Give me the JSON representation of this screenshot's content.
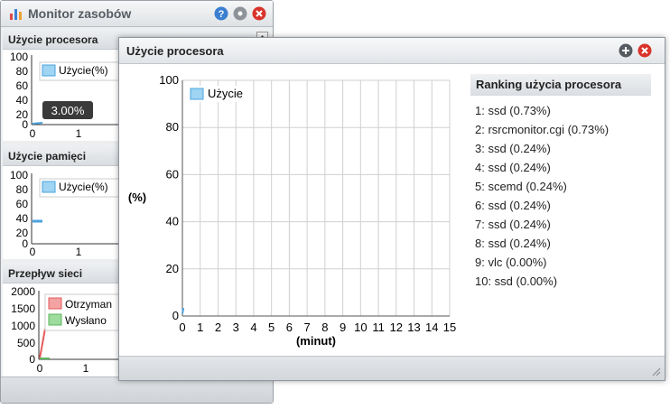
{
  "monitor_window": {
    "title": "Monitor zasobów",
    "sections": {
      "cpu": {
        "title": "Użycie procesora",
        "legend": "Użycie(%)",
        "tooltip": "3.00%",
        "y_ticks": [
          "100",
          "80",
          "60",
          "40",
          "20",
          "0"
        ],
        "x_ticks": [
          "0",
          "1"
        ]
      },
      "memory": {
        "title": "Użycie pamięci",
        "legend": "Użycie(%)",
        "y_ticks": [
          "100",
          "80",
          "60",
          "40",
          "20",
          "0"
        ],
        "x_ticks": [
          "0",
          "1"
        ]
      },
      "network": {
        "title": "Przepływ sieci",
        "legend_received": "Otrzyman",
        "legend_sent": "Wysłano",
        "y_ticks": [
          "2000",
          "1500",
          "1000",
          "500",
          "0"
        ],
        "x_ticks": [
          "0",
          "1"
        ]
      }
    }
  },
  "cpu_window": {
    "title": "Użycie procesora",
    "ranking": {
      "title": "Ranking użycia procesora",
      "items": [
        "1: ssd (0.73%)",
        "2: rsrcmonitor.cgi (0.73%)",
        "3: ssd (0.24%)",
        "4: ssd (0.24%)",
        "5: scemd (0.24%)",
        "6: ssd (0.24%)",
        "7: ssd (0.24%)",
        "8: ssd (0.24%)",
        "9: vlc (0.00%)",
        "10: ssd (0.00%)"
      ]
    }
  },
  "colors": {
    "series_blue": "#4aa3df",
    "received_red": "#e55a5a",
    "sent_green": "#5bb65b"
  },
  "chart_data": {
    "type": "line",
    "ylabel": "(%)",
    "xlabel": "(minut)",
    "ylim": [
      0,
      100
    ],
    "xlim": [
      0,
      15
    ],
    "y_ticks": [
      0,
      20,
      40,
      60,
      80,
      100
    ],
    "x_ticks": [
      0,
      1,
      2,
      3,
      4,
      5,
      6,
      7,
      8,
      9,
      10,
      11,
      12,
      13,
      14,
      15
    ],
    "grid": true,
    "legend": "top-left",
    "series": [
      {
        "name": "Użycie",
        "x": [
          0,
          0.05,
          0.1
        ],
        "y": [
          1,
          3,
          3
        ]
      }
    ]
  }
}
